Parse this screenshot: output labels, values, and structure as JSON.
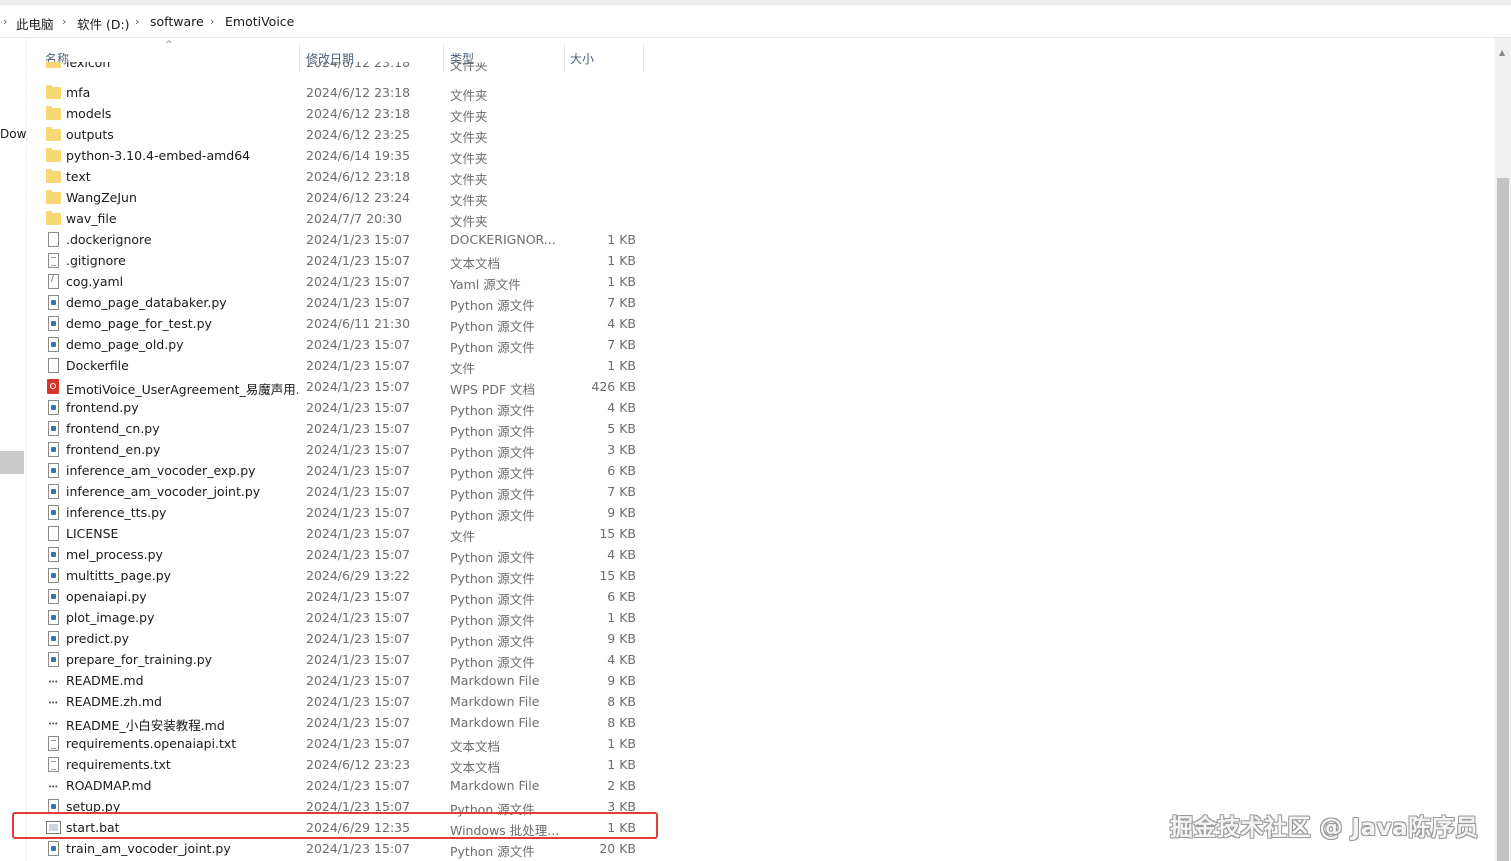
{
  "breadcrumb": [
    "此电脑",
    "软件 (D:)",
    "software",
    "EmotiVoice"
  ],
  "nav": {
    "partial_label": "Dow"
  },
  "columns": {
    "name": "名称",
    "date": "修改日期",
    "type": "类型",
    "size": "大小"
  },
  "partial_row": {
    "name": "lexicon",
    "date": "2024/6/12 23:18",
    "type": "文件夹",
    "size": ""
  },
  "files": [
    {
      "icon": "folder",
      "name": "mfa",
      "date": "2024/6/12 23:18",
      "type": "文件夹",
      "size": ""
    },
    {
      "icon": "folder",
      "name": "models",
      "date": "2024/6/12 23:18",
      "type": "文件夹",
      "size": ""
    },
    {
      "icon": "folder",
      "name": "outputs",
      "date": "2024/6/12 23:25",
      "type": "文件夹",
      "size": ""
    },
    {
      "icon": "folder",
      "name": "python-3.10.4-embed-amd64",
      "date": "2024/6/14 19:35",
      "type": "文件夹",
      "size": ""
    },
    {
      "icon": "folder",
      "name": "text",
      "date": "2024/6/12 23:18",
      "type": "文件夹",
      "size": ""
    },
    {
      "icon": "folder",
      "name": "WangZeJun",
      "date": "2024/6/12 23:24",
      "type": "文件夹",
      "size": ""
    },
    {
      "icon": "folder",
      "name": "wav_file",
      "date": "2024/7/7 20:30",
      "type": "文件夹",
      "size": ""
    },
    {
      "icon": "file",
      "name": ".dockerignore",
      "date": "2024/1/23 15:07",
      "type": "DOCKERIGNOR...",
      "size": "1 KB"
    },
    {
      "icon": "txt",
      "name": ".gitignore",
      "date": "2024/1/23 15:07",
      "type": "文本文档",
      "size": "1 KB"
    },
    {
      "icon": "yaml",
      "name": "cog.yaml",
      "date": "2024/1/23 15:07",
      "type": "Yaml 源文件",
      "size": "1 KB"
    },
    {
      "icon": "py",
      "name": "demo_page_databaker.py",
      "date": "2024/1/23 15:07",
      "type": "Python 源文件",
      "size": "7 KB"
    },
    {
      "icon": "py",
      "name": "demo_page_for_test.py",
      "date": "2024/6/11 21:30",
      "type": "Python 源文件",
      "size": "4 KB"
    },
    {
      "icon": "py",
      "name": "demo_page_old.py",
      "date": "2024/1/23 15:07",
      "type": "Python 源文件",
      "size": "7 KB"
    },
    {
      "icon": "file",
      "name": "Dockerfile",
      "date": "2024/1/23 15:07",
      "type": "文件",
      "size": "1 KB"
    },
    {
      "icon": "pdf",
      "name": "EmotiVoice_UserAgreement_易魔声用...",
      "date": "2024/1/23 15:07",
      "type": "WPS PDF 文档",
      "size": "426 KB"
    },
    {
      "icon": "py",
      "name": "frontend.py",
      "date": "2024/1/23 15:07",
      "type": "Python 源文件",
      "size": "4 KB"
    },
    {
      "icon": "py",
      "name": "frontend_cn.py",
      "date": "2024/1/23 15:07",
      "type": "Python 源文件",
      "size": "5 KB"
    },
    {
      "icon": "py",
      "name": "frontend_en.py",
      "date": "2024/1/23 15:07",
      "type": "Python 源文件",
      "size": "3 KB"
    },
    {
      "icon": "py",
      "name": "inference_am_vocoder_exp.py",
      "date": "2024/1/23 15:07",
      "type": "Python 源文件",
      "size": "6 KB"
    },
    {
      "icon": "py",
      "name": "inference_am_vocoder_joint.py",
      "date": "2024/1/23 15:07",
      "type": "Python 源文件",
      "size": "7 KB"
    },
    {
      "icon": "py",
      "name": "inference_tts.py",
      "date": "2024/1/23 15:07",
      "type": "Python 源文件",
      "size": "9 KB"
    },
    {
      "icon": "file",
      "name": "LICENSE",
      "date": "2024/1/23 15:07",
      "type": "文件",
      "size": "15 KB"
    },
    {
      "icon": "py",
      "name": "mel_process.py",
      "date": "2024/1/23 15:07",
      "type": "Python 源文件",
      "size": "4 KB"
    },
    {
      "icon": "py",
      "name": "multitts_page.py",
      "date": "2024/6/29 13:22",
      "type": "Python 源文件",
      "size": "15 KB"
    },
    {
      "icon": "py",
      "name": "openaiapi.py",
      "date": "2024/1/23 15:07",
      "type": "Python 源文件",
      "size": "6 KB"
    },
    {
      "icon": "py",
      "name": "plot_image.py",
      "date": "2024/1/23 15:07",
      "type": "Python 源文件",
      "size": "1 KB"
    },
    {
      "icon": "py",
      "name": "predict.py",
      "date": "2024/1/23 15:07",
      "type": "Python 源文件",
      "size": "9 KB"
    },
    {
      "icon": "py",
      "name": "prepare_for_training.py",
      "date": "2024/1/23 15:07",
      "type": "Python 源文件",
      "size": "4 KB"
    },
    {
      "icon": "md",
      "name": "README.md",
      "date": "2024/1/23 15:07",
      "type": "Markdown File",
      "size": "9 KB"
    },
    {
      "icon": "md",
      "name": "README.zh.md",
      "date": "2024/1/23 15:07",
      "type": "Markdown File",
      "size": "8 KB"
    },
    {
      "icon": "md",
      "name": "README_小白安装教程.md",
      "date": "2024/1/23 15:07",
      "type": "Markdown File",
      "size": "8 KB"
    },
    {
      "icon": "txt",
      "name": "requirements.openaiapi.txt",
      "date": "2024/1/23 15:07",
      "type": "文本文档",
      "size": "1 KB"
    },
    {
      "icon": "txt",
      "name": "requirements.txt",
      "date": "2024/6/12 23:23",
      "type": "文本文档",
      "size": "1 KB"
    },
    {
      "icon": "md",
      "name": "ROADMAP.md",
      "date": "2024/1/23 15:07",
      "type": "Markdown File",
      "size": "2 KB"
    },
    {
      "icon": "py",
      "name": "setup.py",
      "date": "2024/1/23 15:07",
      "type": "Python 源文件",
      "size": "3 KB"
    },
    {
      "icon": "bat",
      "name": "start.bat",
      "date": "2024/6/29 12:35",
      "type": "Windows 批处理...",
      "size": "1 KB"
    },
    {
      "icon": "py",
      "name": "train_am_vocoder_joint.py",
      "date": "2024/1/23 15:07",
      "type": "Python 源文件",
      "size": "20 KB"
    }
  ],
  "highlighted_file": "start.bat",
  "highlight_color": "#e43a3a",
  "folder_color": "#f8d775",
  "watermark": "掘金技术社区 @ Java陈序员"
}
